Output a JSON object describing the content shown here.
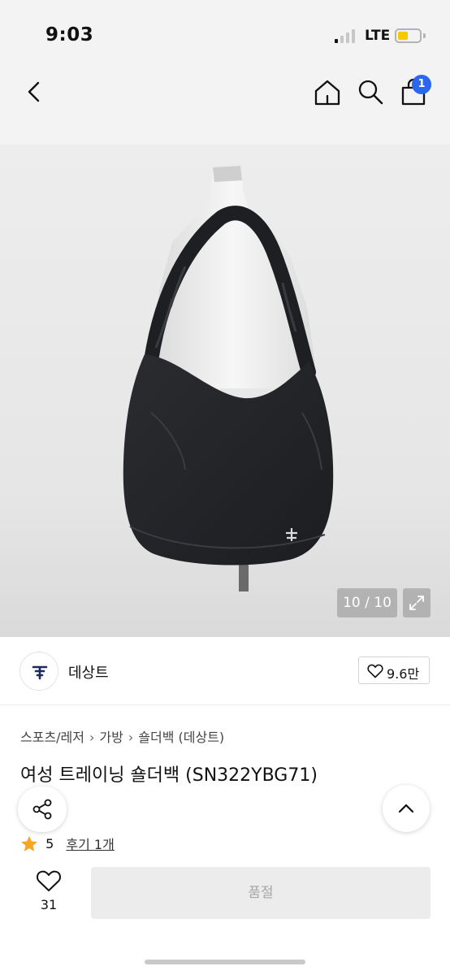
{
  "status_bar": {
    "time": "9:03",
    "network": "LTE",
    "signal_bars_active": 1,
    "signal_bars_total": 4,
    "battery_level": 0.35,
    "battery_color": "#f5c800"
  },
  "nav": {
    "back_icon": "chevron-left-icon",
    "home_icon": "home-icon",
    "search_icon": "search-icon",
    "cart_icon": "shopping-bag-icon",
    "cart_count": "1",
    "badge_color": "#2a66f0"
  },
  "gallery": {
    "counter": "10 / 10",
    "expand_icon": "expand-icon"
  },
  "brand": {
    "name": "데상트",
    "logo_icon": "descente-logo-icon",
    "likes": "9.6만"
  },
  "breadcrumb": [
    "스포츠/레저",
    "가방",
    "숄더백 (데상트)"
  ],
  "product": {
    "title": "여성 트레이닝 숄더백 (SN322YBG71)"
  },
  "rating": {
    "score": "5",
    "reviews_label": "후기 1개",
    "star_color": "#f5a623"
  },
  "actions": {
    "wish_count": "31",
    "buy_label": "품절",
    "share_icon": "share-icon",
    "scroll_top_icon": "chevron-up-icon"
  }
}
